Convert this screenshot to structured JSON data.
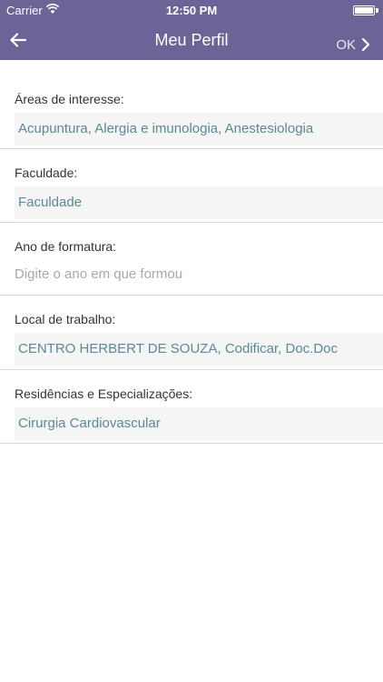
{
  "status_bar": {
    "carrier": "Carrier",
    "time": "12:50 PM"
  },
  "header": {
    "title": "Meu Perfil",
    "ok_label": "OK",
    "back_icon": "arrow-left-icon",
    "forward_icon": "chevron-right-icon"
  },
  "colors": {
    "header_bg": "#6b6497",
    "value_text": "#5b8a92",
    "field_bg": "#f5f5f5"
  },
  "form": {
    "areas": {
      "label": "Áreas de interesse:",
      "value": "Acupuntura, Alergia e imunologia, Anestesiologia"
    },
    "faculdade": {
      "label": "Faculdade:",
      "value": "Faculdade"
    },
    "ano": {
      "label": "Ano de formatura:",
      "placeholder": "Digite o ano em que formou"
    },
    "local": {
      "label": "Local de trabalho:",
      "value": "CENTRO HERBERT DE SOUZA, Codificar, Doc.Doc"
    },
    "residencias": {
      "label": "Residências e Especializações:",
      "value": "Cirurgia Cardiovascular"
    }
  }
}
